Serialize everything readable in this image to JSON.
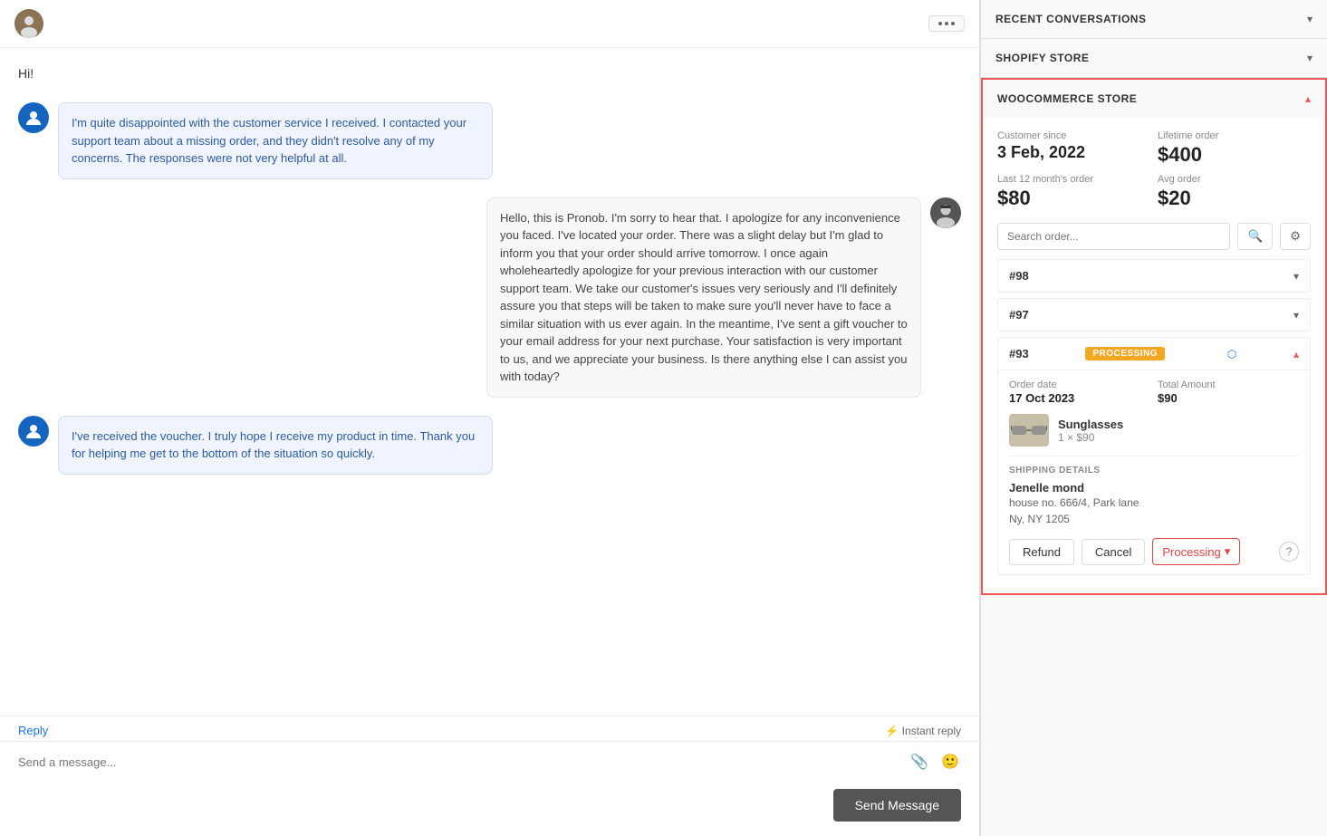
{
  "header": {
    "dots_label": "⋯"
  },
  "chat": {
    "greeting": "Hi!",
    "messages": [
      {
        "id": 1,
        "type": "customer",
        "text": "I'm quite disappointed with the customer service I received. I contacted your support team about a missing order, and they didn't resolve any of my concerns. The responses were not very helpful at all."
      },
      {
        "id": 2,
        "type": "agent",
        "text": "Hello, this is Pronob. I'm sorry to hear that. I apologize for any inconvenience you faced. I've located your order. There was a slight delay but I'm glad to inform you that your order should arrive tomorrow. I once again wholeheartedly apologize for your previous interaction with our customer support team. We take our customer's issues very seriously and I'll definitely assure you that steps will be taken to make sure you'll never have to face a similar situation with us ever again. In the meantime, I've sent a gift voucher to your email address for your next purchase. Your satisfaction is very important to us, and we appreciate your business. Is there anything else I can assist you with today?"
      },
      {
        "id": 3,
        "type": "customer",
        "text": "I've received the voucher. I truly hope I receive my product in time. Thank you for helping me get to the bottom of the situation so quickly."
      }
    ],
    "reply_label": "Reply",
    "instant_reply_label": "⚡ Instant reply",
    "input_placeholder": "Send a message...",
    "send_button": "Send Message"
  },
  "sidebar": {
    "recent_conversations_label": "RECENT CONVERSATIONS",
    "shopify_store_label": "SHOPIFY STORE",
    "woocommerce_label": "WOOCOMMERCE STORE",
    "customer_since_label": "Customer since",
    "customer_since_value": "3 Feb, 2022",
    "lifetime_order_label": "Lifetime order",
    "lifetime_order_value": "$400",
    "last12_label": "Last 12 month's order",
    "last12_value": "$80",
    "avg_order_label": "Avg order",
    "avg_order_value": "$20",
    "search_placeholder": "Search order...",
    "orders": [
      {
        "id": "#98",
        "expanded": false,
        "status": null
      },
      {
        "id": "#97",
        "expanded": false,
        "status": null
      },
      {
        "id": "#93",
        "expanded": true,
        "status": "PROCESSING",
        "order_date_label": "Order date",
        "order_date_value": "17 Oct 2023",
        "total_label": "Total Amount",
        "total_value": "$90",
        "product_name": "Sunglasses",
        "product_qty": "1 × $90",
        "shipping_title": "SHIPPING DETAILS",
        "shipping_name": "Jenelle mond",
        "shipping_address_line1": "house no. 666/4, Park lane",
        "shipping_address_line2": "Ny, NY 1205"
      }
    ],
    "refund_btn": "Refund",
    "cancel_btn": "Cancel",
    "processing_btn": "Processing",
    "processing_chevron": "▾"
  }
}
